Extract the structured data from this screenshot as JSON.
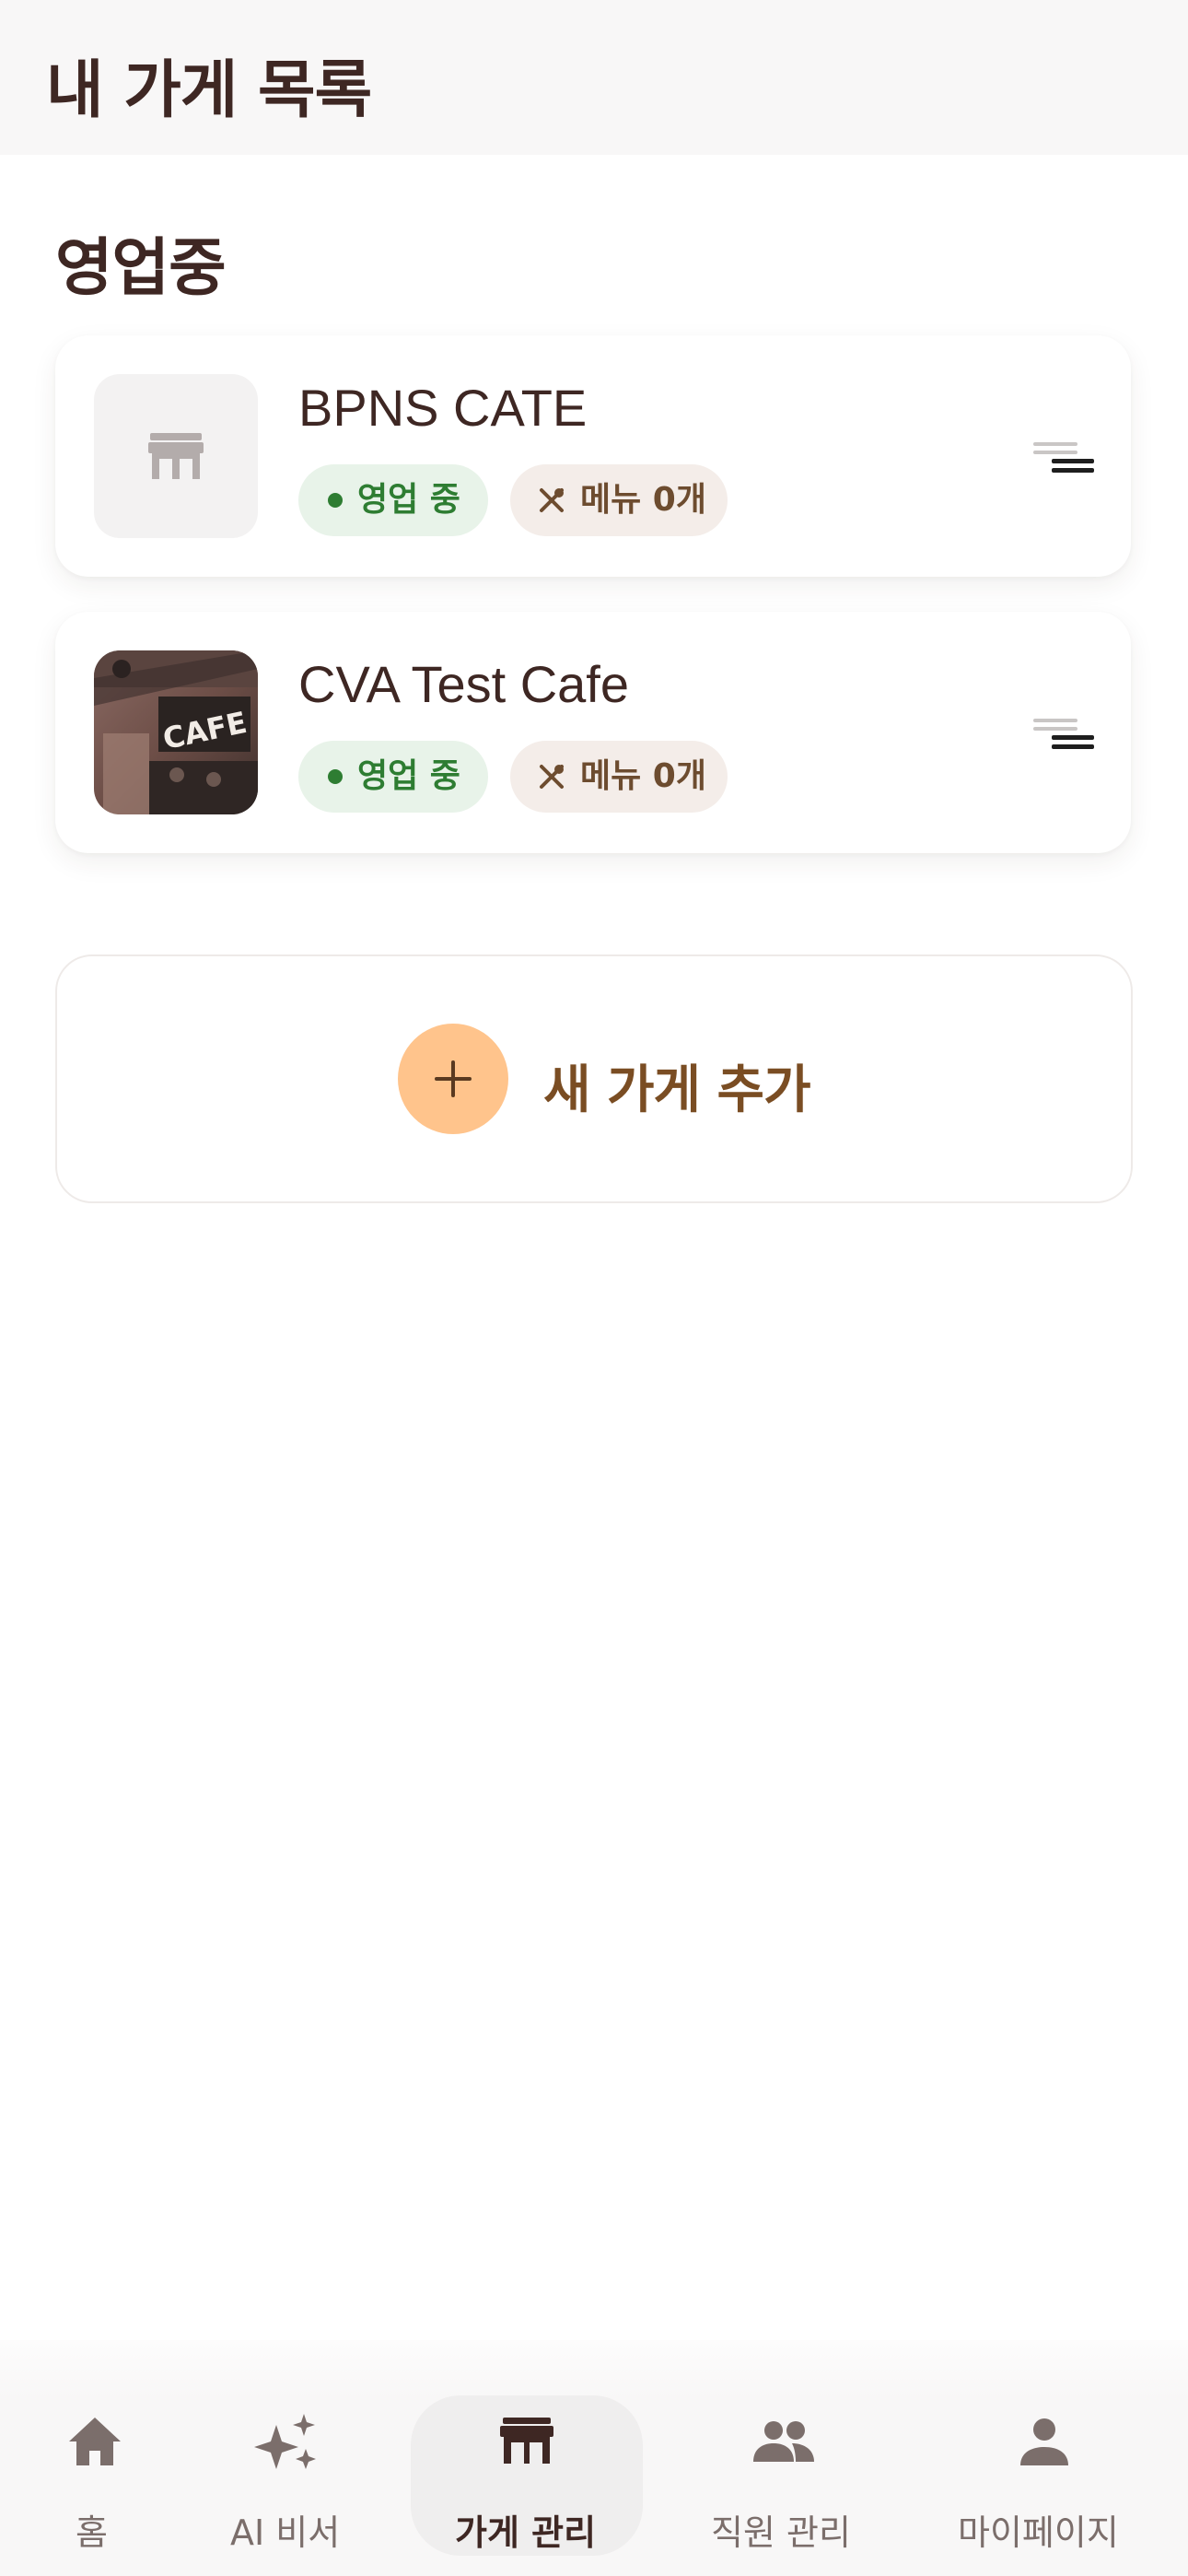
{
  "header": {
    "title": "내 가게 목록"
  },
  "section": {
    "title": "영업중"
  },
  "stores": [
    {
      "name": "BPNS CATE",
      "status": "영업 중",
      "menu_count": "메뉴 0개",
      "thumbnail": "store-placeholder-icon"
    },
    {
      "name": "CVA Test Cafe",
      "status": "영업 중",
      "menu_count": "메뉴 0개",
      "thumbnail": "cafe-photo"
    }
  ],
  "add_store": {
    "label": "새 가게 추가"
  },
  "nav": {
    "items": [
      {
        "label": "홈",
        "icon": "home-icon"
      },
      {
        "label": "AI 비서",
        "icon": "sparkle-icon"
      },
      {
        "label": "가게 관리",
        "icon": "store-icon",
        "active": true
      },
      {
        "label": "직원 관리",
        "icon": "people-icon"
      },
      {
        "label": "마이페이지",
        "icon": "person-icon"
      }
    ]
  },
  "colors": {
    "primary_text": "#3e2723",
    "status_green": "#2e7d32",
    "status_bg": "#e8f3e9",
    "menu_chip_bg": "#f4ede9",
    "accent_orange": "#ffc48c",
    "add_text": "#7a4d23"
  }
}
